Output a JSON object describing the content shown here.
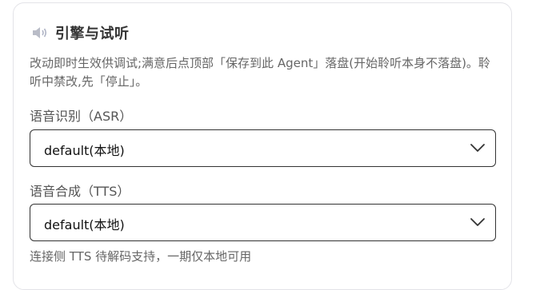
{
  "section": {
    "icon": "speaker-icon",
    "title": "引擎与试听",
    "description": "改动即时生效供调试;满意后点顶部「保存到此 Agent」落盘(开始聆听本身不落盘)。聆听中禁改,先「停止」。"
  },
  "asr": {
    "label": "语音识别（ASR）",
    "selected": "default(本地)"
  },
  "tts": {
    "label": "语音合成（TTS）",
    "selected": "default(本地)",
    "hint": "连接侧 TTS 待解码支持，一期仅本地可用"
  },
  "colors": {
    "border": "#333333",
    "card_border": "#e3e3e8",
    "text_muted": "#666666"
  }
}
